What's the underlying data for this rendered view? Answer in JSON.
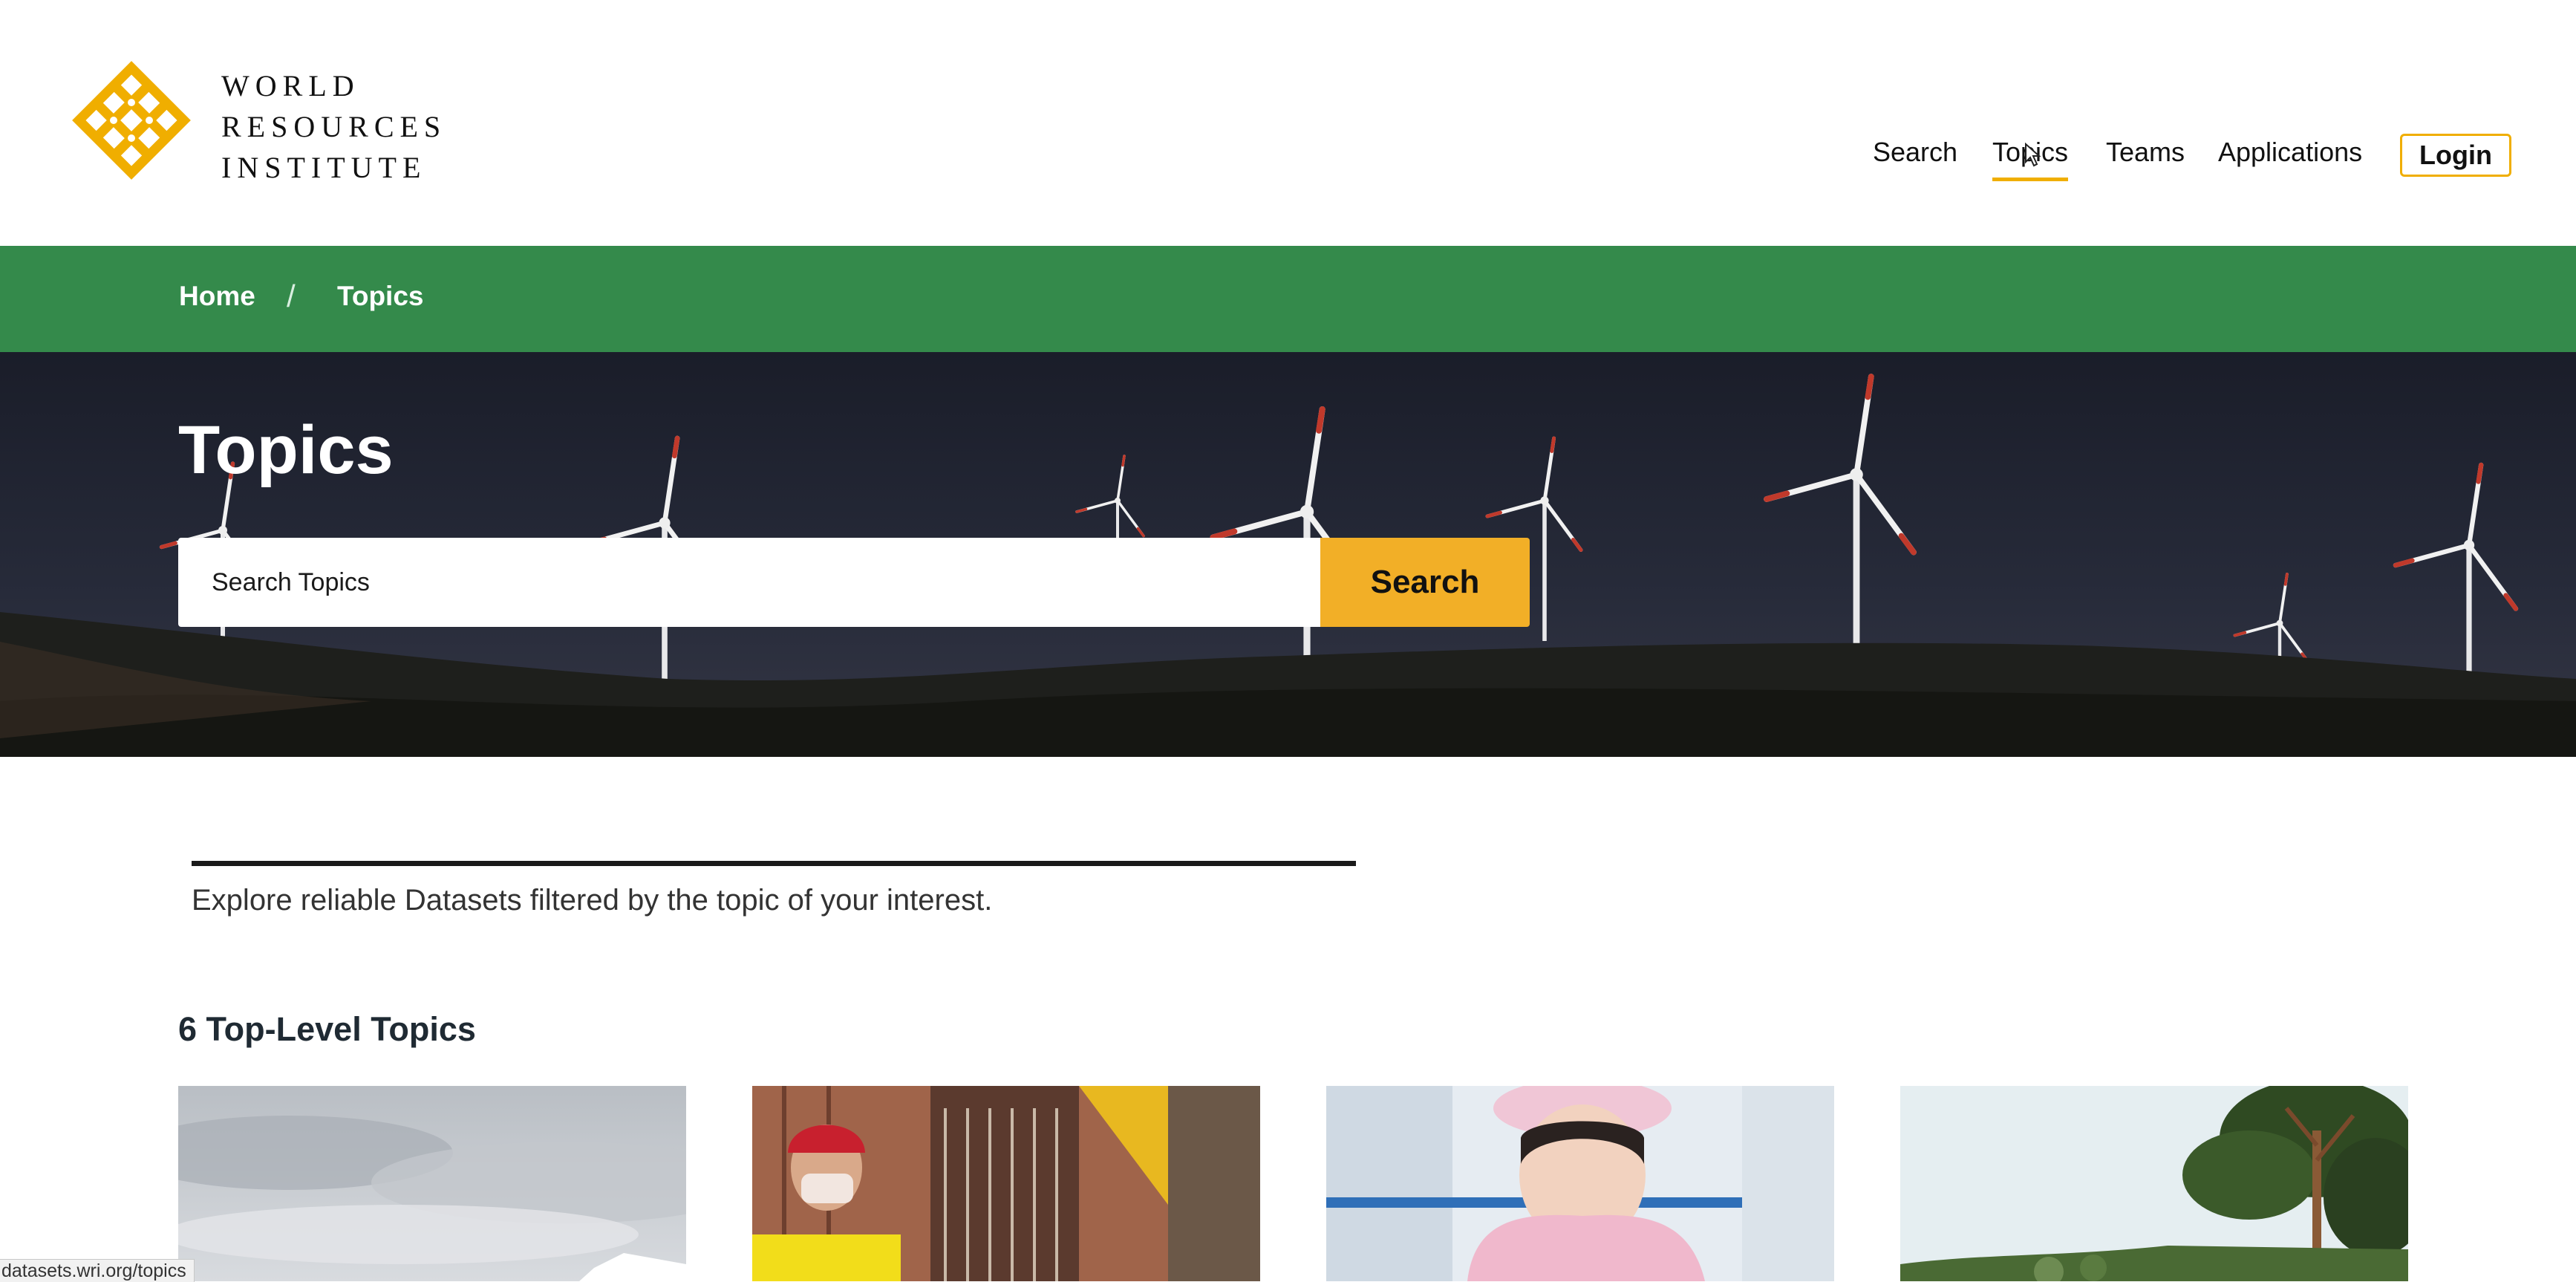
{
  "header": {
    "logo_lines": [
      "WORLD",
      "RESOURCES",
      "INSTITUTE"
    ],
    "nav": {
      "search": "Search",
      "topics": "Topics",
      "teams": "Teams",
      "applications": "Applications",
      "login": "Login"
    },
    "active_nav": "Topics"
  },
  "breadcrumb": {
    "home": "Home",
    "separator": "/",
    "current": "Topics"
  },
  "hero": {
    "title": "Topics",
    "search_placeholder": "Search Topics",
    "search_value": "",
    "search_button": "Search"
  },
  "intro": {
    "text": "Explore reliable Datasets filtered by the topic of your interest."
  },
  "topics_section": {
    "heading": "6 Top-Level Topics",
    "cards": [
      {
        "image": "cloudy-sky-photo"
      },
      {
        "image": "cyclist-in-mask-photo"
      },
      {
        "image": "factory-worker-photo"
      },
      {
        "image": "forest-trees-photo"
      }
    ]
  },
  "status_bar": {
    "url": "datasets.wri.org/topics"
  },
  "colors": {
    "brand_yellow": "#f0ae00",
    "breadcrumb_green": "#348a4b",
    "search_button": "#f2af27",
    "hero_dark": "#1b1e2b"
  }
}
